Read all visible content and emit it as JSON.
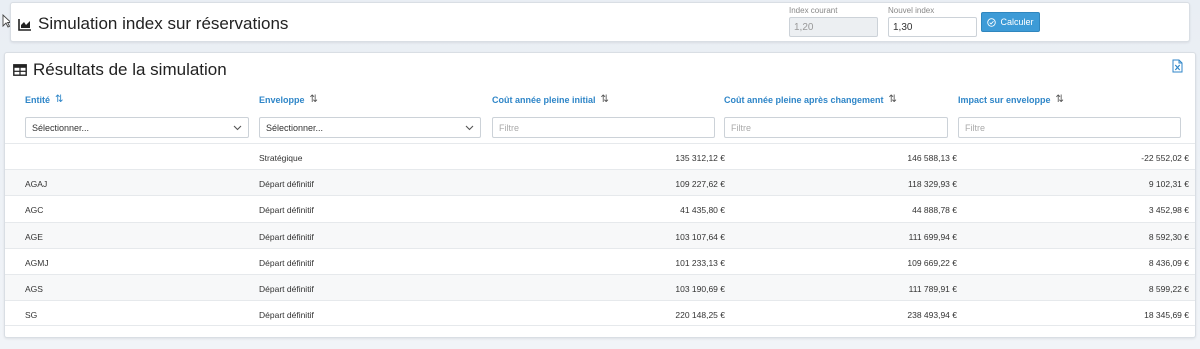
{
  "header": {
    "title": "Simulation index sur réservations",
    "index_courant_label": "Index courant",
    "index_courant_value": "1,20",
    "nouvel_index_label": "Nouvel index",
    "nouvel_index_value": "1,30",
    "calculer_label": "Calculer"
  },
  "results": {
    "title": "Résultats de la simulation",
    "columns": [
      "Entité",
      "Enveloppe",
      "Coût année pleine initial",
      "Coût année pleine après changement",
      "Impact sur enveloppe"
    ],
    "filters": {
      "select_placeholder": "Sélectionner...",
      "text_placeholder": "Filtre"
    },
    "rows": [
      {
        "entite": "",
        "enveloppe": "Stratégique",
        "initial": "135 312,12 €",
        "apres": "146 588,13 €",
        "impact": "-22 552,02 €"
      },
      {
        "entite": "AGAJ",
        "enveloppe": "Départ définitif",
        "initial": "109 227,62 €",
        "apres": "118 329,93 €",
        "impact": "9 102,31 €"
      },
      {
        "entite": "AGC",
        "enveloppe": "Départ définitif",
        "initial": "41 435,80 €",
        "apres": "44 888,78 €",
        "impact": "3 452,98 €"
      },
      {
        "entite": "AGE",
        "enveloppe": "Départ définitif",
        "initial": "103 107,64 €",
        "apres": "111 699,94 €",
        "impact": "8 592,30 €"
      },
      {
        "entite": "AGMJ",
        "enveloppe": "Départ définitif",
        "initial": "101 233,13 €",
        "apres": "109 669,22 €",
        "impact": "8 436,09 €"
      },
      {
        "entite": "AGS",
        "enveloppe": "Départ définitif",
        "initial": "103 190,69 €",
        "apres": "111 789,91 €",
        "impact": "8 599,22 €"
      },
      {
        "entite": "SG",
        "enveloppe": "Départ définitif",
        "initial": "220 148,25 €",
        "apres": "238 493,94 €",
        "impact": "18 345,69 €"
      }
    ]
  }
}
